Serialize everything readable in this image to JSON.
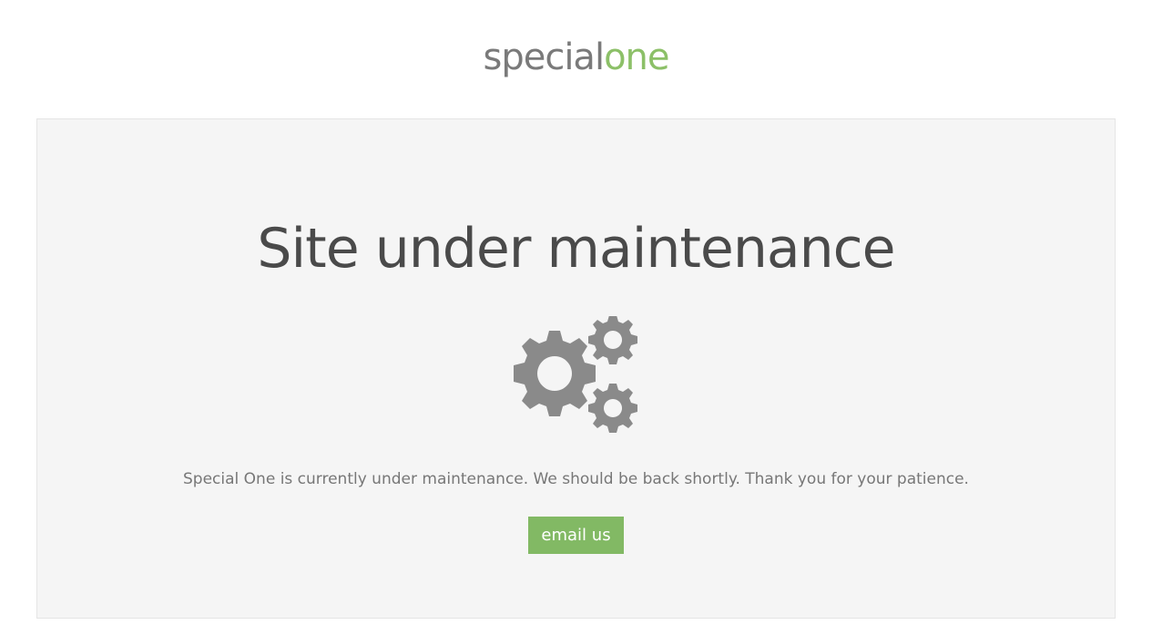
{
  "header": {
    "logo_part1": "special",
    "logo_part2": "one"
  },
  "main": {
    "title": "Site under maintenance",
    "icon": "gears-icon",
    "message": "Special One is currently under maintenance. We should be back shortly. Thank you for your patience.",
    "button_label": "email us"
  },
  "colors": {
    "brand_green": "#82b964",
    "panel_bg": "#f5f5f5",
    "icon_gray": "#8a8a8a"
  }
}
